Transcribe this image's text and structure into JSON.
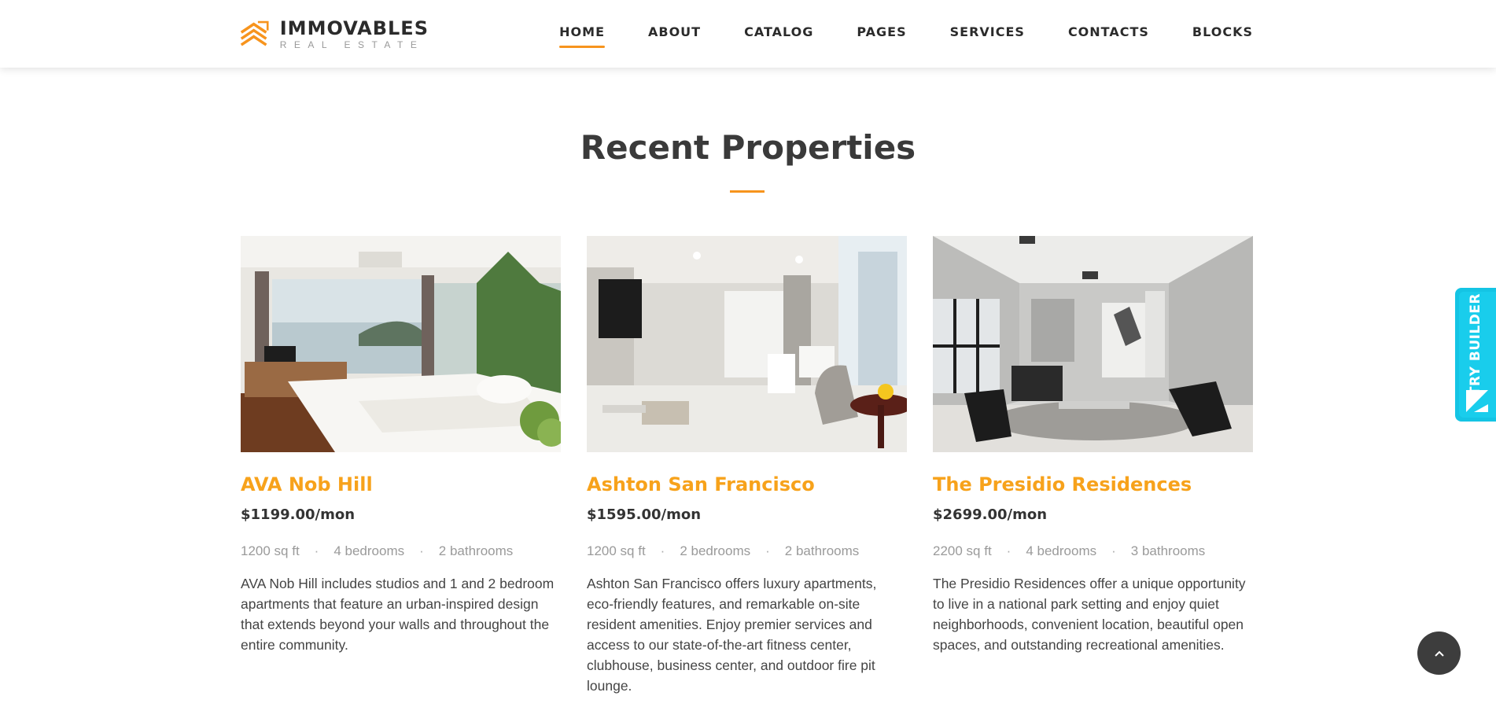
{
  "brand": {
    "title": "IMMOVABLES",
    "subtitle": "REAL ESTATE",
    "accent_color": "#f7941d",
    "logo_icon": "stacked-chevrons-logo-icon"
  },
  "nav": {
    "items": [
      {
        "label": "HOME",
        "active": true
      },
      {
        "label": "ABOUT",
        "active": false
      },
      {
        "label": "CATALOG",
        "active": false
      },
      {
        "label": "PAGES",
        "active": false
      },
      {
        "label": "SERVICES",
        "active": false
      },
      {
        "label": "CONTACTS",
        "active": false
      },
      {
        "label": "BLOCKS",
        "active": false
      }
    ]
  },
  "section": {
    "title": "Recent Properties"
  },
  "properties": [
    {
      "name": "AVA Nob Hill",
      "price": "$1199.00/mon",
      "area": "1200 sq ft",
      "bedrooms": "4 bedrooms",
      "bathrooms": "2 bathrooms",
      "description": "AVA Nob Hill includes studios and 1 and 2 bedroom apartments that feature an urban-inspired design that extends beyond your walls and throughout the entire community.",
      "image": "bedroom-sea-view-photo"
    },
    {
      "name": "Ashton San Francisco",
      "price": "$1595.00/mon",
      "area": "1200 sq ft",
      "bedrooms": "2 bedrooms",
      "bathrooms": "2 bathrooms",
      "description": "Ashton San Francisco offers luxury apartments, eco-friendly features, and remarkable on-site resident amenities. Enjoy premier services and access to our state-of-the-art fitness center, clubhouse, business center, and outdoor fire pit lounge.",
      "image": "white-living-room-photo"
    },
    {
      "name": "The Presidio Residences",
      "price": "$2699.00/mon",
      "area": "2200 sq ft",
      "bedrooms": "4 bedrooms",
      "bathrooms": "3 bathrooms",
      "description": "The Presidio Residences offer a unique opportunity to live in a national park setting and enjoy quiet neighborhoods, convenient location, beautiful open spaces, and outstanding recreational amenities.",
      "image": "grey-lounge-room-photo"
    }
  ],
  "widgets": {
    "try_builder_label": "TRY BUILDER",
    "try_builder_color": "#19cdec",
    "back_to_top_icon": "chevron-up-icon"
  }
}
